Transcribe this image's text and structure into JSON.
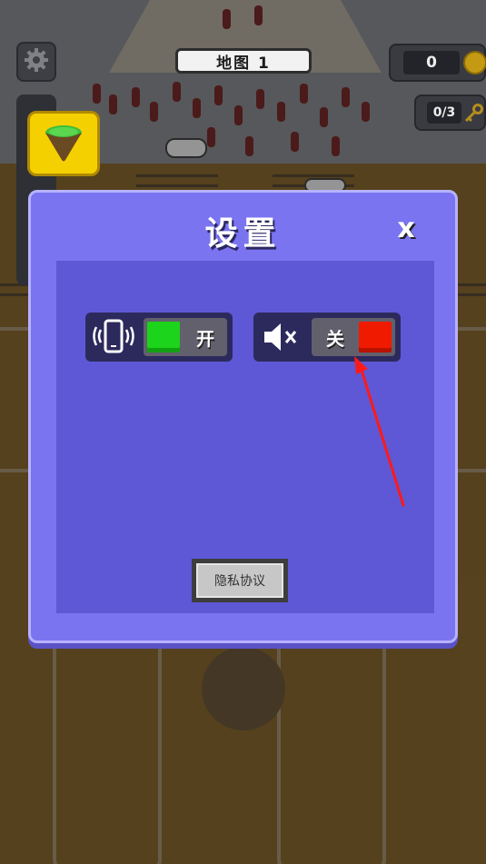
{
  "hud": {
    "map_label": "地图 1",
    "coins": "0",
    "keys": "0/3",
    "icons": {
      "settings": "gear-icon",
      "coin": "coin-icon",
      "key": "key-icon",
      "island": "island-icon"
    }
  },
  "settings": {
    "title": "设置",
    "close_label": "x",
    "vibration": {
      "icon": "vibration-phone-icon",
      "state_label": "开",
      "on": true,
      "knob_color": "#1bd41b"
    },
    "sound": {
      "icon": "speaker-muted-icon",
      "state_label": "关",
      "on": false,
      "knob_color": "#f01a00"
    },
    "privacy_label": "隐私协议"
  },
  "colors": {
    "modal_bg": "#7b74f0",
    "panel_bg": "#5e58d6",
    "annotation_arrow": "#ff1a1a"
  }
}
